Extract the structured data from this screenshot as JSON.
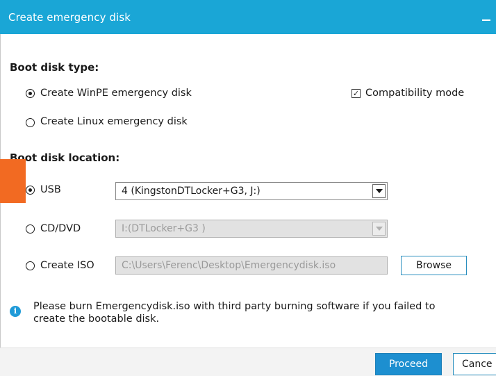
{
  "window": {
    "title": "Create emergency disk"
  },
  "boot_disk_type": {
    "heading": "Boot disk type:",
    "options": [
      {
        "label": "Create WinPE emergency disk",
        "selected": true
      },
      {
        "label": "Create Linux emergency disk",
        "selected": false
      }
    ],
    "compatibility_mode": {
      "label": "Compatibility mode",
      "checked": true
    }
  },
  "boot_disk_location": {
    "heading": "Boot disk location:",
    "usb": {
      "label": "USB",
      "selected": true,
      "value": "4 (KingstonDTLocker+G3, J:)"
    },
    "cd_dvd": {
      "label": "CD/DVD",
      "selected": false,
      "value": "I:(DTLocker+G3     )"
    },
    "iso": {
      "label": "Create ISO",
      "selected": false,
      "path": "C:\\Users\\Ferenc\\Desktop\\Emergencydisk.iso"
    },
    "browse_label": "Browse"
  },
  "info": {
    "line1": "Please burn Emergencydisk.iso with third party burning software if you failed to",
    "line2": "create the bootable disk."
  },
  "footer": {
    "proceed_label": "Proceed",
    "cancel_label": "Cance"
  },
  "colors": {
    "titlebar": "#1aa6d6",
    "primary_button": "#1d8fd0",
    "marker": "#f26a22"
  }
}
